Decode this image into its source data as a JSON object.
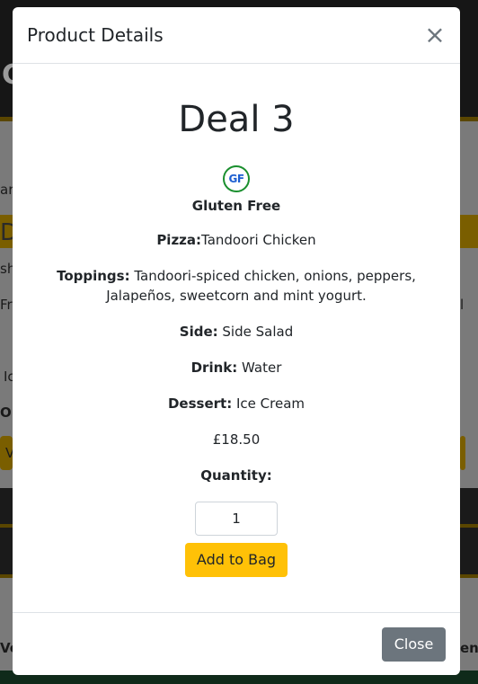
{
  "background": {
    "big_letter": "C",
    "fragments": [
      "ari",
      "D",
      "sh",
      "Fr",
      "l",
      "Ic",
      "Or",
      "V",
      "Ve",
      "en"
    ]
  },
  "modal": {
    "title": "Product Details",
    "close_icon": "×",
    "product": {
      "name": "Deal 3",
      "badge_icon_text": "GF",
      "badge_label": "Gluten Free",
      "pizza_label": "Pizza:",
      "pizza_value": "Tandoori Chicken",
      "toppings_label": "Toppings:",
      "toppings_value": " Tandoori-spiced chicken, onions, peppers, Jalapeños, sweetcorn and mint yogurt.",
      "side_label": "Side:",
      "side_value": " Side Salad",
      "drink_label": "Drink:",
      "drink_value": " Water",
      "dessert_label": "Dessert:",
      "dessert_value": " Ice Cream",
      "price": "£18.50"
    },
    "quantity_label": "Quantity:",
    "quantity_value": "1",
    "add_button": "Add to Bag",
    "close_button": "Close"
  },
  "colors": {
    "accent_yellow": "#ffc107",
    "secondary_gray": "#6c757d",
    "gf_green": "#1a8f2e",
    "gf_blue": "#1e5fd1"
  }
}
